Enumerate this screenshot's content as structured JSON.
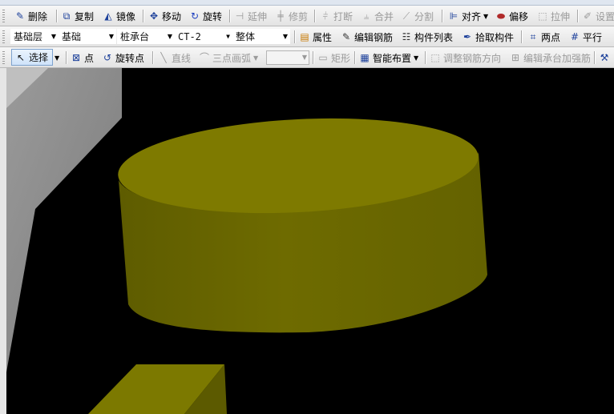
{
  "toolbar1": {
    "delete": "删除",
    "copy": "复制",
    "mirror": "镜像",
    "move": "移动",
    "rotate": "旋转",
    "extend": "延伸",
    "trim": "修剪",
    "break": "打断",
    "merge": "合并",
    "split": "分割",
    "align": "对齐",
    "offset": "偏移",
    "stretch": "拉伸",
    "settings": "设置"
  },
  "toolbar2": {
    "floor_select": "基础层",
    "category_select": "基础",
    "component_type_select": "桩承台",
    "component_name_select": "CT-2",
    "part_select": "整体",
    "properties": "属性",
    "edit_rebar": "编辑钢筋",
    "component_list": "构件列表",
    "pick_component": "拾取构件",
    "two_points": "两点",
    "parallel": "平行"
  },
  "toolbar3": {
    "select": "选择",
    "point": "点",
    "rotate_point": "旋转点",
    "line": "直线",
    "three_point_arc": "三点画弧",
    "rectangle": "矩形",
    "smart_layout": "智能布置",
    "adjust_rebar_direction": "调整钢筋方向",
    "edit_cap_reinforcement": "编辑承台加强筋"
  },
  "scene": {
    "background_color": "#000000",
    "cylinder_top_color": "#7e7a00",
    "cylinder_side_color": "#6c6a00",
    "wall_color": "#8e8e8e"
  }
}
